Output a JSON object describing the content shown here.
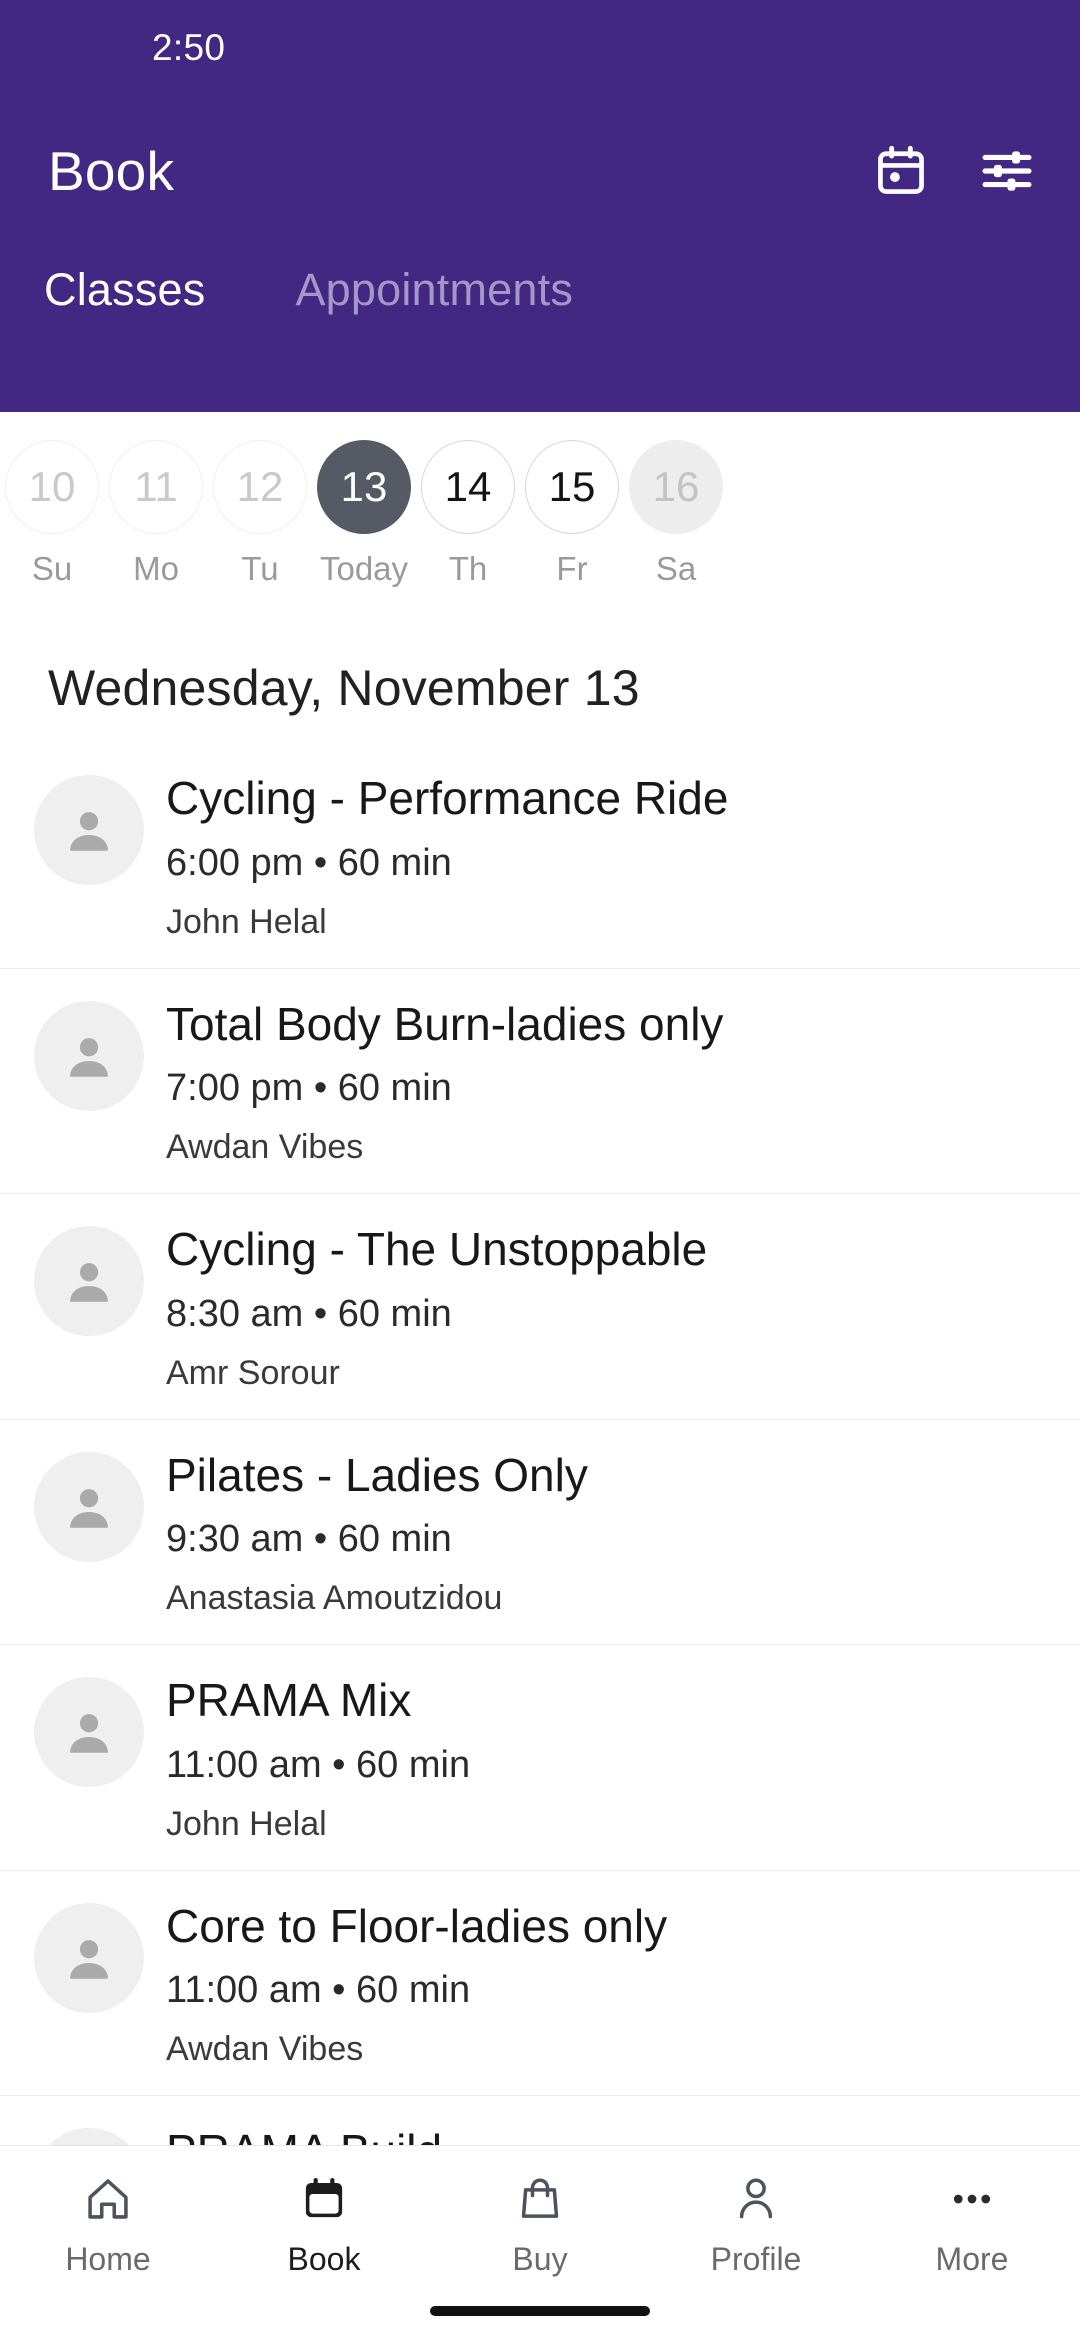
{
  "theme": {
    "header_purple": "#422783",
    "selected_day": "#565a64",
    "inactive_tab": "#a498c9",
    "avatar_bg": "#efefef",
    "divider": "#ececec"
  },
  "status_bar": {
    "time": "2:50"
  },
  "app_bar": {
    "title": "Book",
    "calendar_icon": "calendar-icon",
    "filter_icon": "filter-sliders-icon"
  },
  "tabs": [
    {
      "label": "Classes",
      "active": true
    },
    {
      "label": "Appointments",
      "active": false
    }
  ],
  "date_strip": [
    {
      "day": "10",
      "dow": "Su",
      "state": "past"
    },
    {
      "day": "11",
      "dow": "Mo",
      "state": "past"
    },
    {
      "day": "12",
      "dow": "Tu",
      "state": "past"
    },
    {
      "day": "13",
      "dow": "Today",
      "state": "sel"
    },
    {
      "day": "14",
      "dow": "Th",
      "state": "norm"
    },
    {
      "day": "15",
      "dow": "Fr",
      "state": "norm"
    },
    {
      "day": "16",
      "dow": "Sa",
      "state": "muted"
    }
  ],
  "day_heading": "Wednesday, November 13",
  "classes": [
    {
      "name": "Cycling - Performance Ride",
      "meta": "6:00 pm • 60 min",
      "instructor": "John Helal"
    },
    {
      "name": "Total Body Burn-ladies only",
      "meta": "7:00 pm • 60 min",
      "instructor": "Awdan Vibes"
    },
    {
      "name": "Cycling - The Unstoppable",
      "meta": "8:30 am • 60 min",
      "instructor": "Amr Sorour"
    },
    {
      "name": "Pilates - Ladies Only",
      "meta": "9:30 am • 60 min",
      "instructor": "Anastasia Amoutzidou"
    },
    {
      "name": "PRAMA Mix",
      "meta": "11:00 am • 60 min",
      "instructor": "John Helal"
    },
    {
      "name": "Core to Floor-ladies only",
      "meta": "11:00 am • 60 min",
      "instructor": "Awdan Vibes"
    },
    {
      "name": "PRAMA Build",
      "meta": "",
      "instructor": ""
    }
  ],
  "bottom_nav": [
    {
      "label": "Home",
      "icon": "home-icon",
      "active": false
    },
    {
      "label": "Book",
      "icon": "calendar-icon",
      "active": true
    },
    {
      "label": "Buy",
      "icon": "bag-icon",
      "active": false
    },
    {
      "label": "Profile",
      "icon": "person-icon",
      "active": false
    },
    {
      "label": "More",
      "icon": "ellipsis-icon",
      "active": false
    }
  ]
}
